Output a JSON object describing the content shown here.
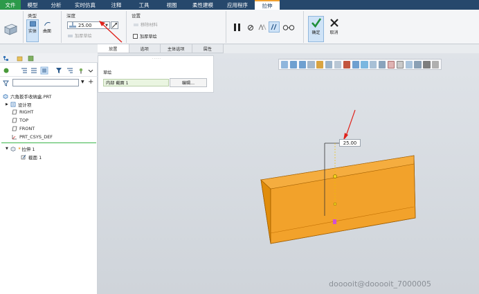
{
  "menu": {
    "tabs": [
      "文件",
      "模型",
      "分析",
      "实时仿真",
      "注释",
      "工具",
      "视图",
      "柔性建模",
      "应用程序",
      "拉伸"
    ],
    "active_tab": "拉伸"
  },
  "ribbon": {
    "type_group": {
      "title": "类型",
      "solid_label": "实体",
      "surface_label": "曲面"
    },
    "depth_group": {
      "title": "深度",
      "value": "25.00",
      "remove_label": "加厚草绘"
    },
    "settings_group": {
      "title": "设置",
      "remove_material_label": "移除材料",
      "thicken_label": "加厚草绘",
      "thicken_sketch_label": "加厚草绘"
    },
    "confirm_label": "确定",
    "cancel_label": "取消"
  },
  "dashboard_tabs": [
    "放置",
    "选项",
    "主体选项",
    "属性"
  ],
  "placement_panel": {
    "label": "草绘",
    "sketch_field": "内部 截面 1",
    "edit_button": "编辑..."
  },
  "model_tree": {
    "root": "六角扳手收纳盒.PRT",
    "items": [
      "设计项",
      "RIGHT",
      "TOP",
      "FRONT",
      "PRT_CSYS_DEF"
    ],
    "feature": "拉伸 1",
    "sub_feature": "截面 1"
  },
  "viewport": {
    "dimension_value": "25.00",
    "solid_color": "#f39c12"
  },
  "watermark": "dooooit@dooooit_7000005"
}
